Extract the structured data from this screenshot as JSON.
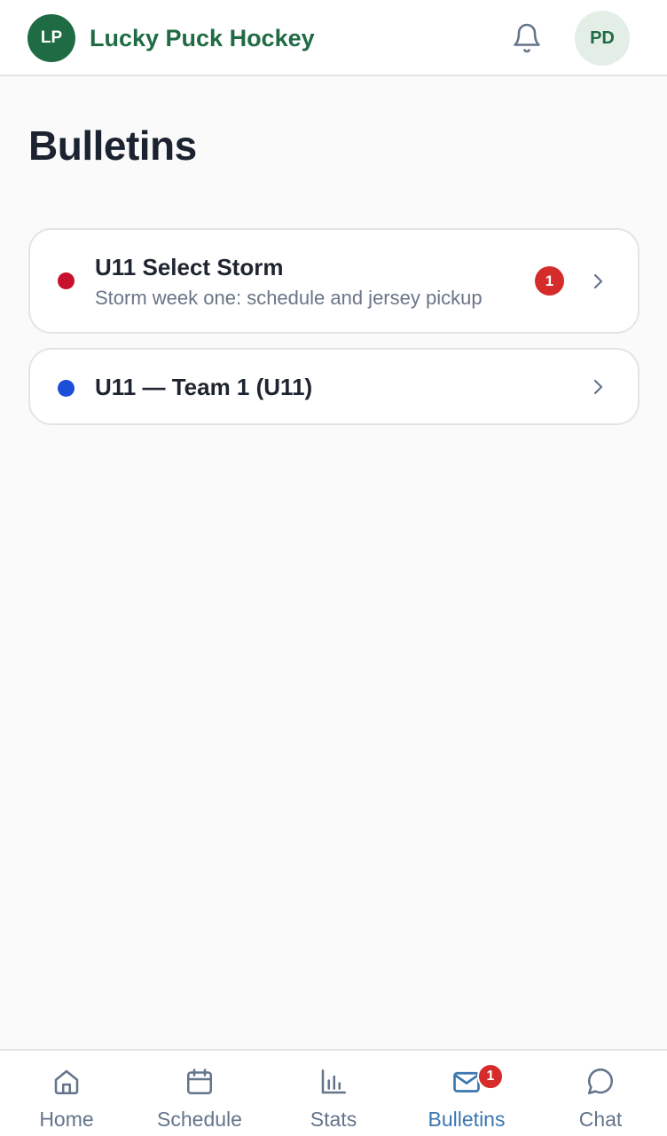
{
  "header": {
    "logo_initials": "LP",
    "brand": "Lucky Puck Hockey",
    "notifications_icon": "bell-icon",
    "user_initials": "PD"
  },
  "page": {
    "title": "Bulletins"
  },
  "bulletins": [
    {
      "team": "U11 Select Storm",
      "preview": "Storm week one: schedule and jersey pickup",
      "unread_count": "1",
      "team_color": "#c8102e"
    },
    {
      "team": "U11 — Team 1 (U11)",
      "team_color": "#1d4ed8"
    }
  ],
  "nav": {
    "items": [
      {
        "label": "Home",
        "icon": "home-icon"
      },
      {
        "label": "Schedule",
        "icon": "calendar-icon"
      },
      {
        "label": "Stats",
        "icon": "bar-chart-icon"
      },
      {
        "label": "Bulletins",
        "icon": "mail-icon",
        "badge": "1",
        "active": true
      },
      {
        "label": "Chat",
        "icon": "chat-bubble-icon"
      }
    ]
  },
  "colors": {
    "brand": "#1f6b43",
    "active_nav": "#3b77b0",
    "badge": "#d52b2b"
  }
}
